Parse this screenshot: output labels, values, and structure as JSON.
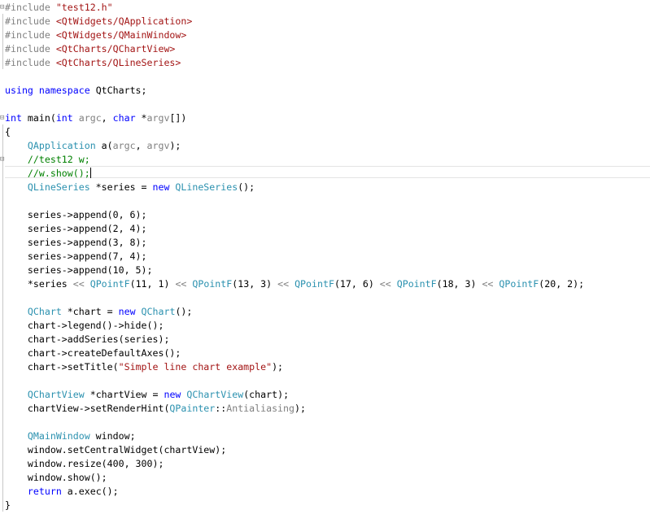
{
  "editor": {
    "lines": [
      {
        "fold": "⊟",
        "tokens": [
          {
            "t": "#include ",
            "c": "pp"
          },
          {
            "t": "\"test12.h\"",
            "c": "str"
          }
        ]
      },
      {
        "fold": "",
        "tokens": [
          {
            "t": "#include ",
            "c": "pp"
          },
          {
            "t": "<QtWidgets/QApplication>",
            "c": "str"
          }
        ]
      },
      {
        "fold": "",
        "tokens": [
          {
            "t": "#include ",
            "c": "pp"
          },
          {
            "t": "<QtWidgets/QMainWindow>",
            "c": "str"
          }
        ]
      },
      {
        "fold": "",
        "tokens": [
          {
            "t": "#include ",
            "c": "pp"
          },
          {
            "t": "<QtCharts/QChartView>",
            "c": "str"
          }
        ]
      },
      {
        "fold": "",
        "tokens": [
          {
            "t": "#include ",
            "c": "pp"
          },
          {
            "t": "<QtCharts/QLineSeries>",
            "c": "str"
          }
        ]
      },
      {
        "fold": "",
        "tokens": []
      },
      {
        "fold": "",
        "tokens": [
          {
            "t": "using namespace ",
            "c": "kw"
          },
          {
            "t": "QtCharts;",
            "c": "pl"
          }
        ]
      },
      {
        "fold": "",
        "tokens": []
      },
      {
        "fold": "⊟",
        "tokens": [
          {
            "t": "int ",
            "c": "kw"
          },
          {
            "t": "main(",
            "c": "pl"
          },
          {
            "t": "int ",
            "c": "kw"
          },
          {
            "t": "argc",
            "c": "pa"
          },
          {
            "t": ", ",
            "c": "pl"
          },
          {
            "t": "char ",
            "c": "kw"
          },
          {
            "t": "*",
            "c": "pl"
          },
          {
            "t": "argv",
            "c": "pa"
          },
          {
            "t": "[])",
            "c": "pl"
          }
        ]
      },
      {
        "fold": "",
        "tokens": [
          {
            "t": "{",
            "c": "pl"
          }
        ]
      },
      {
        "fold": "",
        "tokens": [
          {
            "t": "    ",
            "c": "pl"
          },
          {
            "t": "QApplication",
            "c": "ty"
          },
          {
            "t": " a(",
            "c": "pl"
          },
          {
            "t": "argc",
            "c": "pa"
          },
          {
            "t": ", ",
            "c": "pl"
          },
          {
            "t": "argv",
            "c": "pa"
          },
          {
            "t": ");",
            "c": "pl"
          }
        ]
      },
      {
        "fold": "⊟",
        "tokens": [
          {
            "t": "    //test12 w;",
            "c": "cm"
          }
        ]
      },
      {
        "fold": "",
        "tokens": [
          {
            "t": "    //w.show();",
            "c": "cm"
          }
        ],
        "caret": true
      },
      {
        "fold": "",
        "tokens": [
          {
            "t": "    ",
            "c": "pl"
          },
          {
            "t": "QLineSeries",
            "c": "ty"
          },
          {
            "t": " *series = ",
            "c": "pl"
          },
          {
            "t": "new ",
            "c": "kw"
          },
          {
            "t": "QLineSeries",
            "c": "ty"
          },
          {
            "t": "();",
            "c": "pl"
          }
        ]
      },
      {
        "fold": "",
        "tokens": []
      },
      {
        "fold": "",
        "tokens": [
          {
            "t": "    series->append(0, 6);",
            "c": "pl"
          }
        ]
      },
      {
        "fold": "",
        "tokens": [
          {
            "t": "    series->append(2, 4);",
            "c": "pl"
          }
        ]
      },
      {
        "fold": "",
        "tokens": [
          {
            "t": "    series->append(3, 8);",
            "c": "pl"
          }
        ]
      },
      {
        "fold": "",
        "tokens": [
          {
            "t": "    series->append(7, 4);",
            "c": "pl"
          }
        ]
      },
      {
        "fold": "",
        "tokens": [
          {
            "t": "    series->append(10, 5);",
            "c": "pl"
          }
        ]
      },
      {
        "fold": "",
        "tokens": [
          {
            "t": "    *series ",
            "c": "pl"
          },
          {
            "t": "<<",
            "c": "pa"
          },
          {
            "t": " ",
            "c": "pl"
          },
          {
            "t": "QPointF",
            "c": "ty"
          },
          {
            "t": "(11, 1) ",
            "c": "pl"
          },
          {
            "t": "<<",
            "c": "pa"
          },
          {
            "t": " ",
            "c": "pl"
          },
          {
            "t": "QPointF",
            "c": "ty"
          },
          {
            "t": "(13, 3) ",
            "c": "pl"
          },
          {
            "t": "<<",
            "c": "pa"
          },
          {
            "t": " ",
            "c": "pl"
          },
          {
            "t": "QPointF",
            "c": "ty"
          },
          {
            "t": "(17, 6) ",
            "c": "pl"
          },
          {
            "t": "<<",
            "c": "pa"
          },
          {
            "t": " ",
            "c": "pl"
          },
          {
            "t": "QPointF",
            "c": "ty"
          },
          {
            "t": "(18, 3) ",
            "c": "pl"
          },
          {
            "t": "<<",
            "c": "pa"
          },
          {
            "t": " ",
            "c": "pl"
          },
          {
            "t": "QPointF",
            "c": "ty"
          },
          {
            "t": "(20, 2);",
            "c": "pl"
          }
        ]
      },
      {
        "fold": "",
        "tokens": []
      },
      {
        "fold": "",
        "tokens": [
          {
            "t": "    ",
            "c": "pl"
          },
          {
            "t": "QChart",
            "c": "ty"
          },
          {
            "t": " *chart = ",
            "c": "pl"
          },
          {
            "t": "new ",
            "c": "kw"
          },
          {
            "t": "QChart",
            "c": "ty"
          },
          {
            "t": "();",
            "c": "pl"
          }
        ]
      },
      {
        "fold": "",
        "tokens": [
          {
            "t": "    chart->legend()->hide();",
            "c": "pl"
          }
        ]
      },
      {
        "fold": "",
        "tokens": [
          {
            "t": "    chart->addSeries(series);",
            "c": "pl"
          }
        ]
      },
      {
        "fold": "",
        "tokens": [
          {
            "t": "    chart->createDefaultAxes();",
            "c": "pl"
          }
        ]
      },
      {
        "fold": "",
        "tokens": [
          {
            "t": "    chart->setTitle(",
            "c": "pl"
          },
          {
            "t": "\"Simple line chart example\"",
            "c": "str"
          },
          {
            "t": ");",
            "c": "pl"
          }
        ]
      },
      {
        "fold": "",
        "tokens": []
      },
      {
        "fold": "",
        "tokens": [
          {
            "t": "    ",
            "c": "pl"
          },
          {
            "t": "QChartView",
            "c": "ty"
          },
          {
            "t": " *chartView = ",
            "c": "pl"
          },
          {
            "t": "new ",
            "c": "kw"
          },
          {
            "t": "QChartView",
            "c": "ty"
          },
          {
            "t": "(chart);",
            "c": "pl"
          }
        ]
      },
      {
        "fold": "",
        "tokens": [
          {
            "t": "    chartView->setRenderHint(",
            "c": "pl"
          },
          {
            "t": "QPainter",
            "c": "ty"
          },
          {
            "t": "::",
            "c": "pl"
          },
          {
            "t": "Antialiasing",
            "c": "pa"
          },
          {
            "t": ");",
            "c": "pl"
          }
        ]
      },
      {
        "fold": "",
        "tokens": []
      },
      {
        "fold": "",
        "tokens": [
          {
            "t": "    ",
            "c": "pl"
          },
          {
            "t": "QMainWindow",
            "c": "ty"
          },
          {
            "t": " window;",
            "c": "pl"
          }
        ]
      },
      {
        "fold": "",
        "tokens": [
          {
            "t": "    window.setCentralWidget(chartView);",
            "c": "pl"
          }
        ]
      },
      {
        "fold": "",
        "tokens": [
          {
            "t": "    window.resize(400, 300);",
            "c": "pl"
          }
        ]
      },
      {
        "fold": "",
        "tokens": [
          {
            "t": "    window.show();",
            "c": "pl"
          }
        ]
      },
      {
        "fold": "",
        "tokens": [
          {
            "t": "    ",
            "c": "pl"
          },
          {
            "t": "return ",
            "c": "kw"
          },
          {
            "t": "a.exec();",
            "c": "pl"
          }
        ]
      },
      {
        "fold": "",
        "tokens": [
          {
            "t": "}",
            "c": "pl"
          }
        ]
      }
    ]
  },
  "colors": {
    "preprocessor": "#808080",
    "string": "#a31515",
    "keyword": "#0000ff",
    "type": "#2b91af",
    "comment": "#008000",
    "parameter": "#808080"
  }
}
